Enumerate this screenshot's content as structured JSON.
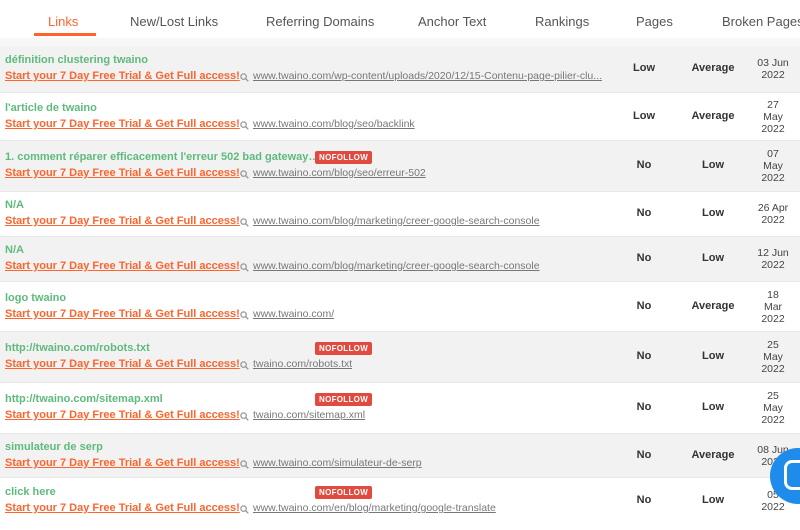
{
  "tabs": [
    {
      "label": "Links",
      "active": true
    },
    {
      "label": "New/Lost Links"
    },
    {
      "label": "Referring Domains"
    },
    {
      "label": "Anchor Text"
    },
    {
      "label": "Rankings"
    },
    {
      "label": "Pages"
    },
    {
      "label": "Broken Pages"
    }
  ],
  "trial_label": "Start your 7 Day Free Trial & Get Full access!",
  "nofollow_label": "NOFOLLOW",
  "colors": {
    "accent": "#ff642d",
    "anchor_green": "#5fba7d",
    "nofollow_red": "#e04a3f",
    "chat_blue": "#1f8ceb"
  },
  "rows": [
    {
      "anchor": "définition clustering twaino",
      "nofollow": false,
      "url": "www.twaino.com/wp-content/uploads/2020/12/15-Contenu-page-pilier-clu...",
      "col1": "Low",
      "col2": "Average",
      "date": [
        "03 Jun",
        "2022"
      ]
    },
    {
      "anchor": "l'article de twaino",
      "nofollow": false,
      "url": "www.twaino.com/blog/seo/backlink",
      "col1": "Low",
      "col2": "Average",
      "date": [
        "27",
        "May",
        "2022"
      ]
    },
    {
      "anchor": "1. comment réparer efficacement l'erreur 502 bad gateway…",
      "nofollow": true,
      "url": "www.twaino.com/blog/seo/erreur-502",
      "col1": "No",
      "col2": "Low",
      "date": [
        "07",
        "May",
        "2022"
      ]
    },
    {
      "anchor": "N/A",
      "nofollow": false,
      "url": "www.twaino.com/blog/marketing/creer-google-search-console",
      "col1": "No",
      "col2": "Low",
      "date": [
        "26 Apr",
        "2022"
      ]
    },
    {
      "anchor": "N/A",
      "nofollow": false,
      "url": "www.twaino.com/blog/marketing/creer-google-search-console",
      "col1": "No",
      "col2": "Low",
      "date": [
        "12 Jun",
        "2022"
      ]
    },
    {
      "anchor": "logo twaino",
      "nofollow": false,
      "url": "www.twaino.com/",
      "col1": "No",
      "col2": "Average",
      "date": [
        "18",
        "Mar",
        "2022"
      ]
    },
    {
      "anchor": "http://twaino.com/robots.txt",
      "nofollow": true,
      "url": "twaino.com/robots.txt",
      "col1": "No",
      "col2": "Low",
      "date": [
        "25",
        "May",
        "2022"
      ]
    },
    {
      "anchor": "http://twaino.com/sitemap.xml",
      "nofollow": true,
      "url": "twaino.com/sitemap.xml",
      "col1": "No",
      "col2": "Low",
      "date": [
        "25",
        "May",
        "2022"
      ]
    },
    {
      "anchor": "simulateur de serp",
      "nofollow": false,
      "url": "www.twaino.com/simulateur-de-serp",
      "col1": "No",
      "col2": "Average",
      "date": [
        "08 Jun",
        "2022"
      ]
    },
    {
      "anchor": "click here",
      "nofollow": true,
      "url": "www.twaino.com/en/blog/marketing/google-translate",
      "col1": "No",
      "col2": "Low",
      "date": [
        "05",
        "2022"
      ]
    }
  ]
}
